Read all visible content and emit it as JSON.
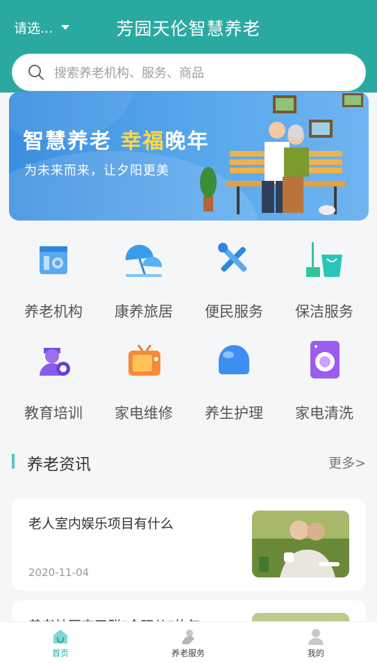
{
  "header": {
    "city": "请选...",
    "title": "芳园天伦智慧养老"
  },
  "search": {
    "placeholder": "搜索养老机构、服务、商品"
  },
  "banner": {
    "title_a": "智慧养老 ",
    "title_hl": "幸福",
    "title_b": "晚年",
    "subtitle": "为未来而来，让夕阳更美"
  },
  "services": [
    {
      "label": "养老机构",
      "icon": "building-icon"
    },
    {
      "label": "康养旅居",
      "icon": "umbrella-beach-icon"
    },
    {
      "label": "便民服务",
      "icon": "tools-icon"
    },
    {
      "label": "保洁服务",
      "icon": "broom-bucket-icon"
    },
    {
      "label": "教育培训",
      "icon": "teacher-icon"
    },
    {
      "label": "家电维修",
      "icon": "tv-repair-icon"
    },
    {
      "label": "养生护理",
      "icon": "care-bubble-icon"
    },
    {
      "label": "家电清洗",
      "icon": "washer-icon"
    }
  ],
  "news": {
    "title": "养老资讯",
    "more": "更多>",
    "items": [
      {
        "title": "老人室内娱乐项目有什么",
        "date": "2020-11-04"
      },
      {
        "title": "养老社区来了群“会玩儿”的年"
      }
    ]
  },
  "tabbar": [
    {
      "label": "首页",
      "active": true,
      "icon": "home-icon"
    },
    {
      "label": "养老服务",
      "active": false,
      "icon": "service-icon"
    },
    {
      "label": "我的",
      "active": false,
      "icon": "profile-icon"
    }
  ],
  "colors": {
    "primary": "#2aa9a0",
    "accent": "#ffd84a"
  }
}
